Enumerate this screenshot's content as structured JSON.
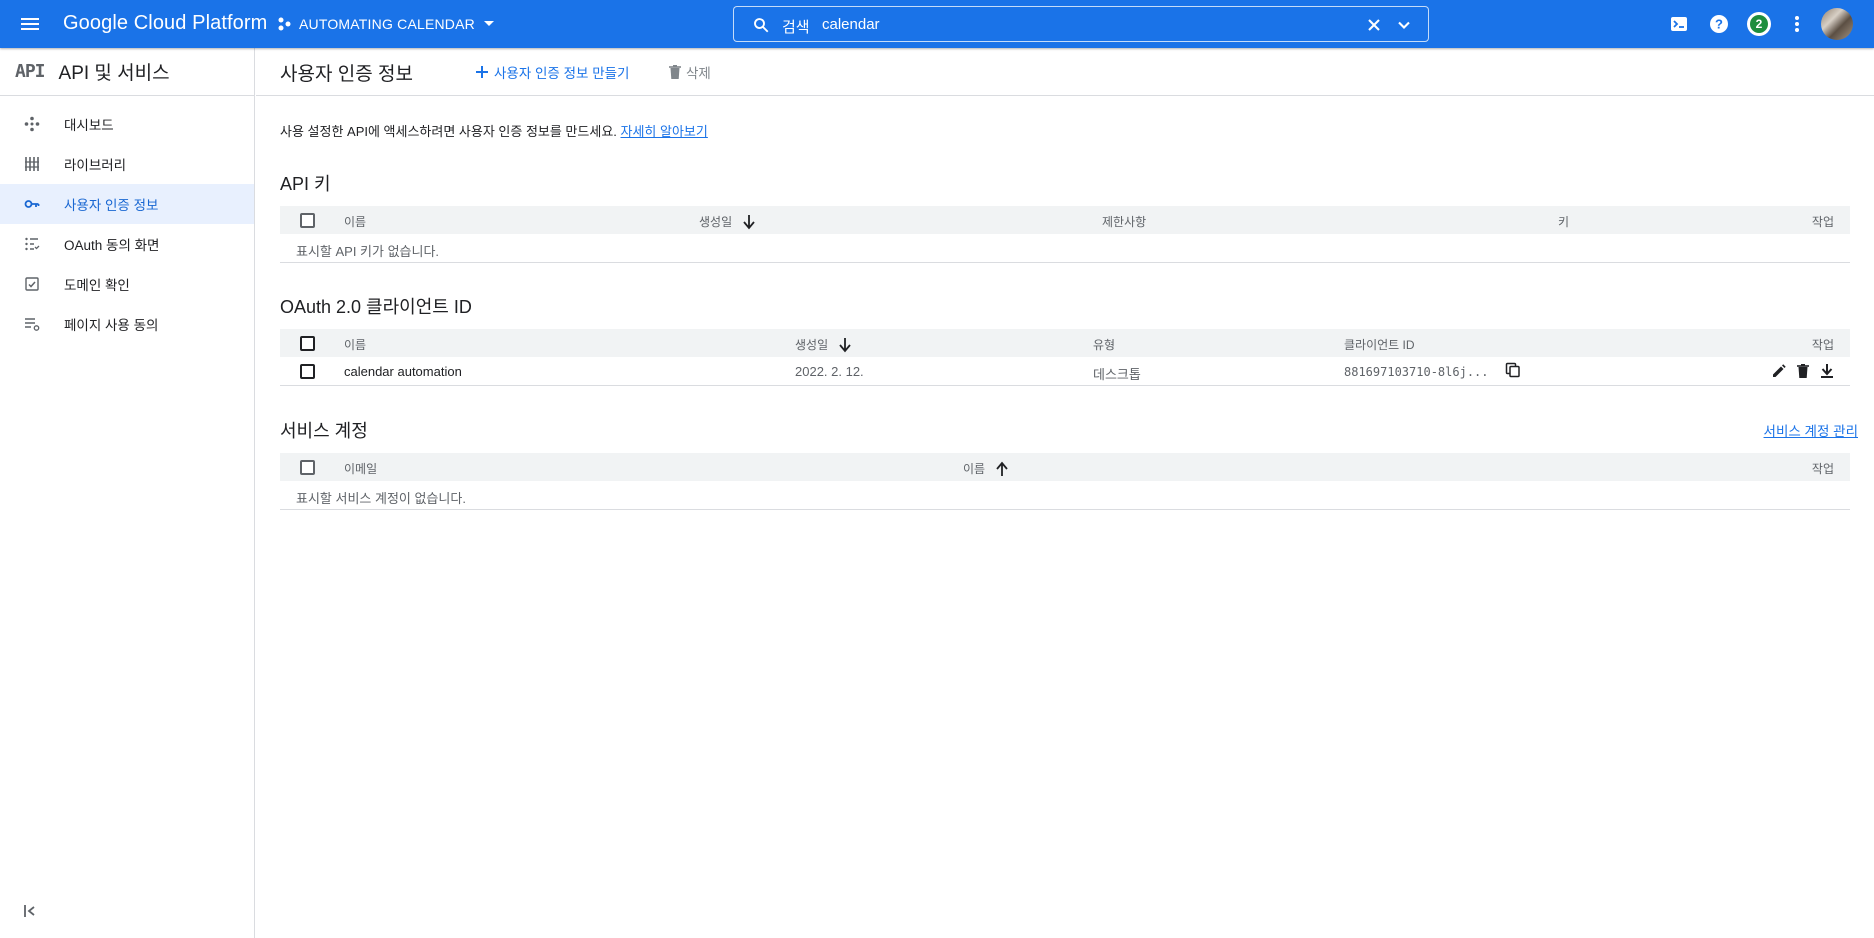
{
  "topbar": {
    "brand": "Google Cloud Platform",
    "project_name": "AUTOMATING CALENDAR",
    "search_label": "검색",
    "search_value": "calendar",
    "notification_count": "2",
    "bg_color": "#1a73e8"
  },
  "sidebar": {
    "logo_text": "API",
    "title": "API 및 서비스",
    "items": [
      {
        "label": "대시보드",
        "icon": "dashboard-icon"
      },
      {
        "label": "라이브러리",
        "icon": "library-icon"
      },
      {
        "label": "사용자 인증 정보",
        "icon": "key-icon",
        "active": true
      },
      {
        "label": "OAuth 동의 화면",
        "icon": "oauth-consent-icon"
      },
      {
        "label": "도메인 확인",
        "icon": "domain-verify-icon"
      },
      {
        "label": "페이지 사용 동의",
        "icon": "page-consent-icon"
      }
    ]
  },
  "main": {
    "title": "사용자 인증 정보",
    "create_label": "사용자 인증 정보 만들기",
    "delete_label": "삭제",
    "intro_text": "사용 설정한 API에 액세스하려면 사용자 인증 정보를 만드세요.",
    "intro_link": "자세히 알아보기"
  },
  "api_keys": {
    "title": "API 키",
    "columns": [
      "이름",
      "생성일",
      "제한사항",
      "키",
      "작업"
    ],
    "empty_text": "표시할 API 키가 없습니다."
  },
  "oauth": {
    "title": "OAuth 2.0 클라이언트 ID",
    "columns": [
      "이름",
      "생성일",
      "유형",
      "클라이언트 ID",
      "작업"
    ],
    "rows": [
      {
        "name": "calendar automation",
        "created": "2022. 2. 12.",
        "type": "데스크톱",
        "client_id": "881697103710-8l6j..."
      }
    ]
  },
  "service_accounts": {
    "title": "서비스 계정",
    "manage_link": "서비스 계정 관리",
    "columns": [
      "이메일",
      "이름",
      "작업"
    ],
    "empty_text": "표시할 서비스 계정이 없습니다."
  }
}
